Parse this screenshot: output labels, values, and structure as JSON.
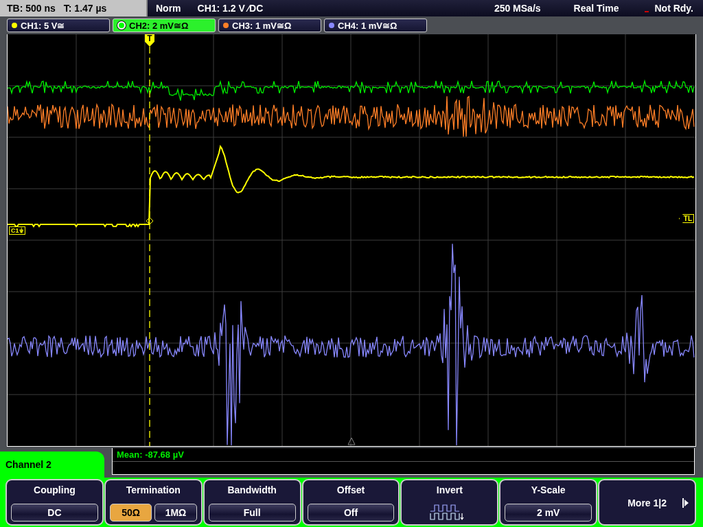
{
  "status_bar": {
    "timebase": "TB: 500 ns",
    "trigger_time": "T: 1.47 µs",
    "trigger_mode": "Norm",
    "trigger_info": "CH1: 1.2 V ⁄DC",
    "sample_rate": "250 MSa/s",
    "acquisition": "Real Time",
    "state": "Not Rdy.",
    "ready": false
  },
  "channel_tabs": [
    {
      "label": "CH1: 5 V≅",
      "color": "#ffff00",
      "selected": false
    },
    {
      "label": "CH2: 2 mV≅Ω",
      "color": "#00ff00",
      "selected": true
    },
    {
      "label": "CH3: 1 mV≅Ω",
      "color": "#ff7f27",
      "selected": false
    },
    {
      "label": "CH4: 1 mV≅Ω",
      "color": "#8888ff",
      "selected": false
    }
  ],
  "trigger_marker": "T",
  "trigger_level_marker": "TL",
  "channel_markers": [
    {
      "label": "C1⏚",
      "color": "#ffff00"
    }
  ],
  "measurement": "Mean: -87.68 µV",
  "menu": {
    "title": "Channel 2",
    "softkeys": [
      {
        "kind": "value",
        "label": "Coupling",
        "value": "DC"
      },
      {
        "kind": "toggle",
        "label": "Termination",
        "options": [
          {
            "label": "50Ω",
            "selected": true
          },
          {
            "label": "1MΩ",
            "selected": false
          }
        ]
      },
      {
        "kind": "value",
        "label": "Bandwidth",
        "value": "Full"
      },
      {
        "kind": "value",
        "label": "Offset",
        "value": "Off"
      },
      {
        "kind": "icon",
        "label": "Invert"
      },
      {
        "kind": "value",
        "label": "Y-Scale",
        "value": "2 mV"
      },
      {
        "kind": "more",
        "label": "More 1|2"
      }
    ]
  }
}
